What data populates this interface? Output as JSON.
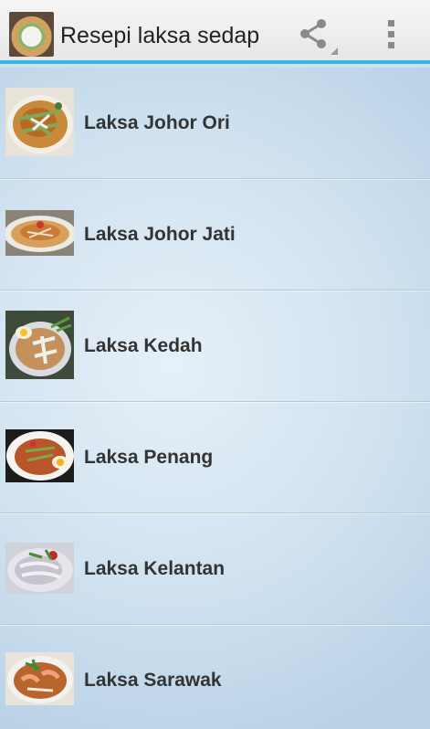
{
  "action_bar": {
    "title": "Resepi laksa sedap",
    "icons": {
      "app": "laksa-bowl-icon",
      "share": "share-icon",
      "overflow": "overflow-menu-icon"
    },
    "accent_color": "#33b5e5"
  },
  "recipes": [
    {
      "label": "Laksa Johor Ori",
      "image": "laksa-johor-ori-photo"
    },
    {
      "label": "Laksa Johor Jati",
      "image": "laksa-johor-jati-photo"
    },
    {
      "label": "Laksa Kedah",
      "image": "laksa-kedah-photo"
    },
    {
      "label": "Laksa Penang",
      "image": "laksa-penang-photo"
    },
    {
      "label": "Laksa Kelantan",
      "image": "laksa-kelantan-photo"
    },
    {
      "label": "Laksa Sarawak",
      "image": "laksa-sarawak-photo"
    }
  ]
}
